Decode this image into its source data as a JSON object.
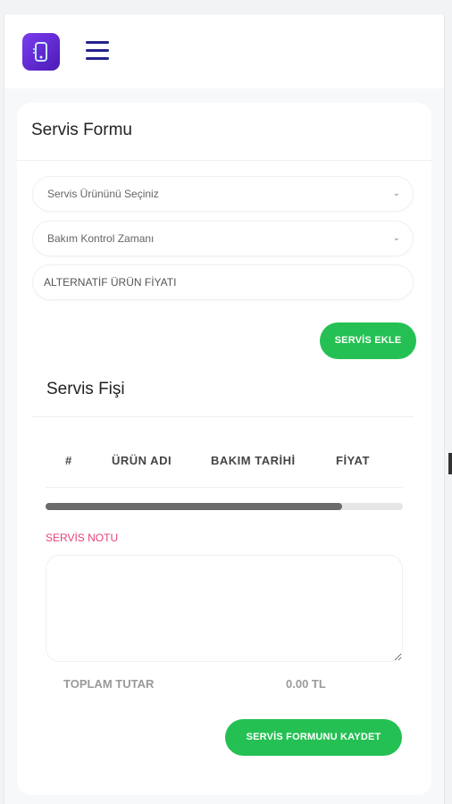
{
  "header": {
    "menu_icon": "hamburger-menu-icon",
    "logo_icon": "phone-app-logo-icon"
  },
  "service_form": {
    "title": "Servis Formu",
    "product_select": {
      "value": "Servis Ürününü Seçiniz",
      "icon": "chevron-down-icon"
    },
    "maintenance_select": {
      "value": "Bakım Kontrol Zamanı",
      "icon": "chevron-down-icon"
    },
    "alt_price_input": {
      "placeholder": "ALTERNATİF ÜRÜN FİYATI"
    },
    "add_button": "SERVİS EKLE"
  },
  "receipt": {
    "title": "Servis Fişi",
    "columns": [
      "#",
      "ÜRÜN ADI",
      "BAKIM TARİHİ",
      "FİYAT"
    ],
    "rows": [],
    "scroll_fraction": 0.83,
    "note_label": "SERVİS NOTU",
    "note_value": "",
    "total_label": "TOPLAM TUTAR",
    "total_value": "0.00 TL",
    "save_button": "SERVİS FORMUNU KAYDET"
  },
  "colors": {
    "accent_green": "#25c053",
    "note_label_pink": "#e8407b",
    "menu_navy": "#24238c",
    "logo_purple": "#6a2be0"
  }
}
